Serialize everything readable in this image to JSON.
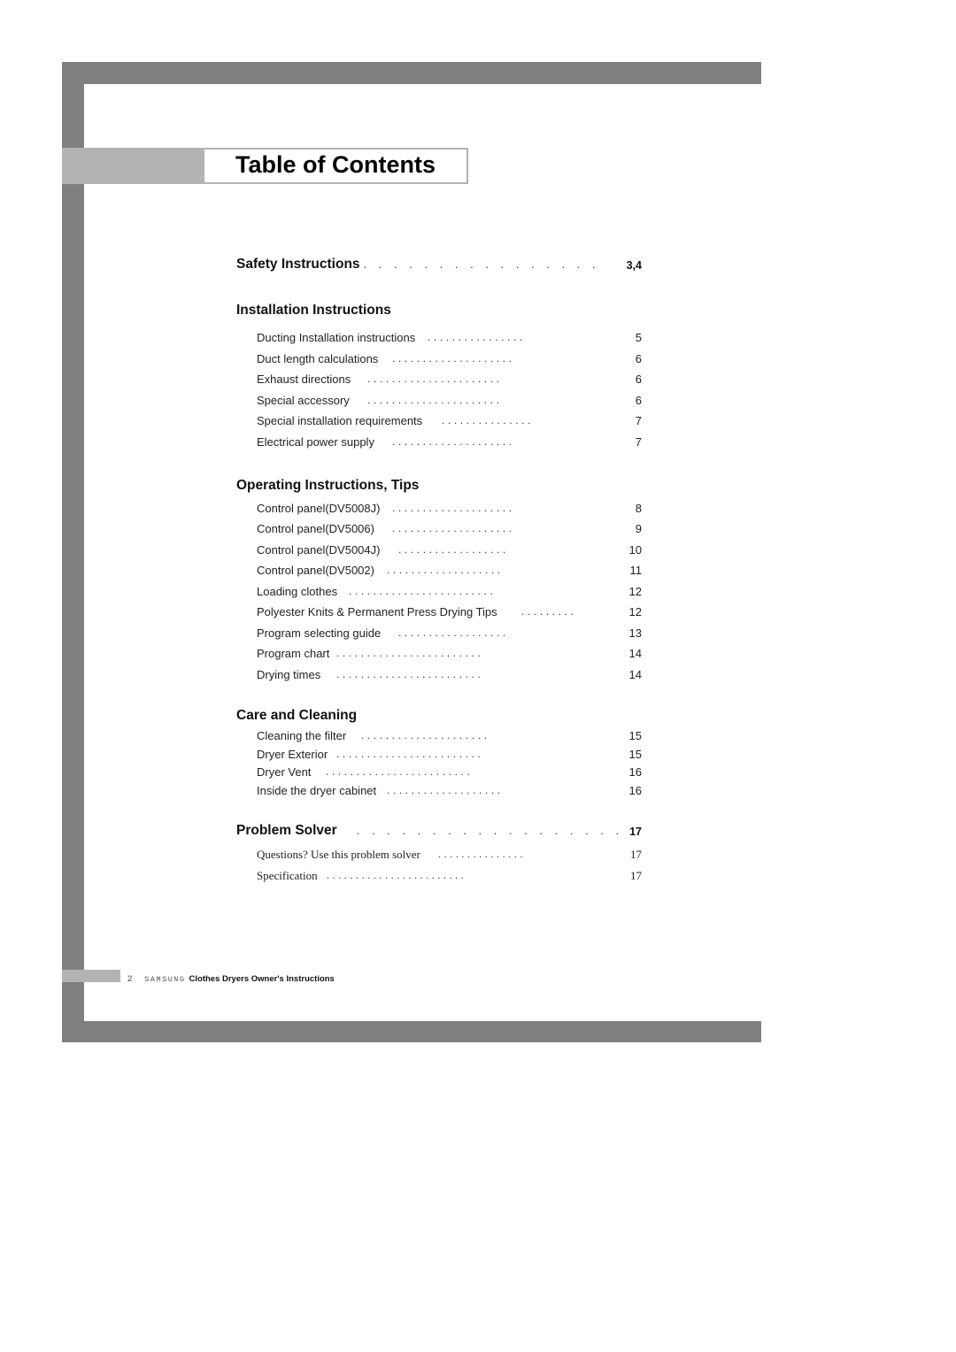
{
  "title": "Table of Contents",
  "sections": [
    {
      "title": "Safety Instructions",
      "dots": ". . . . . . . . . . . . . . . .",
      "page": "3,4",
      "items": []
    },
    {
      "title": "Installation Instructions",
      "dots": "",
      "page": "",
      "items": [
        {
          "title": "Ducting Installation instructions",
          "dots": "................",
          "page": "5"
        },
        {
          "title": "Duct length calculations",
          "dots": "....................",
          "page": "6"
        },
        {
          "title": "Exhaust directions",
          "dots": "......................",
          "page": "6"
        },
        {
          "title": "Special accessory",
          "dots": "......................",
          "page": "6"
        },
        {
          "title": "Special installation requirements",
          "dots": "...............",
          "page": "7"
        },
        {
          "title": "Electrical power supply",
          "dots": "....................",
          "page": "7"
        }
      ]
    },
    {
      "title": "Operating Instructions, Tips",
      "dots": "",
      "page": "",
      "items": [
        {
          "title": "Control panel(DV5008J)",
          "dots": "....................",
          "page": "8"
        },
        {
          "title": "Control panel(DV5006)",
          "dots": "....................",
          "page": "9"
        },
        {
          "title": "Control panel(DV5004J)",
          "dots": "..................",
          "page": "10"
        },
        {
          "title": "Control panel(DV5002)",
          "dots": "...................",
          "page": "11"
        },
        {
          "title": "Loading clothes",
          "dots": "........................",
          "page": "12"
        },
        {
          "title": "Polyester Knits & Permanent Press Drying Tips",
          "dots": ".........",
          "page": "12"
        },
        {
          "title": "Program selecting guide",
          "dots": "..................",
          "page": "13"
        },
        {
          "title": "Program chart",
          "dots": "........................",
          "page": "14"
        },
        {
          "title": "Drying times",
          "dots": "........................",
          "page": "14"
        }
      ]
    },
    {
      "title": "Care and Cleaning",
      "dots": "",
      "page": "",
      "items": [
        {
          "title": "Cleaning the filter",
          "dots": ".....................",
          "page": "15"
        },
        {
          "title": "Dryer Exterior",
          "dots": "........................",
          "page": "15"
        },
        {
          "title": "Dryer Vent",
          "dots": "........................",
          "page": "16"
        },
        {
          "title": "Inside the dryer cabinet",
          "dots": "...................",
          "page": "16"
        }
      ]
    },
    {
      "title": "Problem Solver",
      "dots": ". . . . . . . . . . . . . . . . . .",
      "page": "17",
      "items": [
        {
          "title": "Questions? Use this problem solver",
          "dots": "...............",
          "page": "17"
        },
        {
          "title": "Specification",
          "dots": "........................",
          "page": "17"
        }
      ]
    }
  ],
  "footer": {
    "page_number": "2",
    "brand": "SAMSUNG",
    "document_title": "Clothes Dryers Owner's Instructions"
  }
}
